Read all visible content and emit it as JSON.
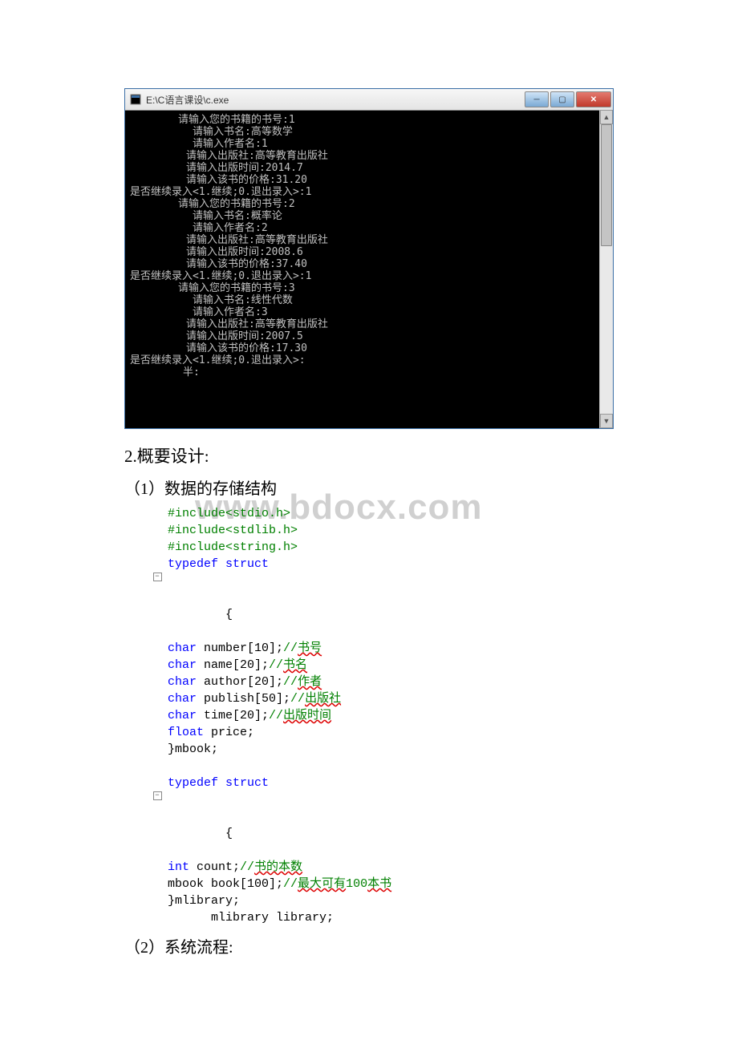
{
  "console": {
    "titlebar": {
      "path": "E:\\C语言课设\\c.exe"
    },
    "lines": [
      {
        "cls": "indent1",
        "t": "请输入您的书籍的书号:1"
      },
      {
        "cls": "indent2",
        "t": "请输入书名:高等数学"
      },
      {
        "cls": "indent2",
        "t": "请输入作者名:1"
      },
      {
        "cls": "indent3",
        "t": "请输入出版社:高等教育出版社"
      },
      {
        "cls": "indent3",
        "t": "请输入出版时间:2014.7"
      },
      {
        "cls": "indent3",
        "t": "请输入该书的价格:31.20"
      },
      {
        "cls": "",
        "t": ""
      },
      {
        "cls": "",
        "t": "是否继续录入<1.继续;0.退出录入>:1"
      },
      {
        "cls": "indent1",
        "t": "请输入您的书籍的书号:2"
      },
      {
        "cls": "indent2",
        "t": "请输入书名:概率论"
      },
      {
        "cls": "indent2",
        "t": "请输入作者名:2"
      },
      {
        "cls": "indent3",
        "t": "请输入出版社:高等教育出版社"
      },
      {
        "cls": "indent3",
        "t": "请输入出版时间:2008.6"
      },
      {
        "cls": "indent3",
        "t": "请输入该书的价格:37.40"
      },
      {
        "cls": "",
        "t": ""
      },
      {
        "cls": "",
        "t": "是否继续录入<1.继续;0.退出录入>:1"
      },
      {
        "cls": "indent1",
        "t": "请输入您的书籍的书号:3"
      },
      {
        "cls": "indent2",
        "t": "请输入书名:线性代数"
      },
      {
        "cls": "indent2",
        "t": "请输入作者名:3"
      },
      {
        "cls": "indent3",
        "t": "请输入出版社:高等教育出版社"
      },
      {
        "cls": "indent3",
        "t": "请输入出版时间:2007.5"
      },
      {
        "cls": "indent3",
        "t": "请输入该书的价格:17.30"
      },
      {
        "cls": "",
        "t": ""
      },
      {
        "cls": "",
        "t": "是否继续录入<1.继续;0.退出录入>:"
      },
      {
        "cls": "indent4",
        "t": "半:"
      }
    ]
  },
  "headings": {
    "section2": "2.概要设计:",
    "sub1": "（1）数据的存储结构",
    "sub2": "（2）系统流程:"
  },
  "watermark": "www.bdocx.com",
  "code": {
    "l1a": "#include",
    "l1b": "<stdio.h>",
    "l2a": "#include",
    "l2b": "<stdlib.h>",
    "l3a": "#include",
    "l3b": "<string.h>",
    "l4a": "typedef",
    "l4b": " struct",
    "l5": "{",
    "l6a": "char",
    "l6b": " number[10];",
    "l6c": "//",
    "l6d": "书号",
    "l7a": "char",
    "l7b": " name[20];",
    "l7c": "//",
    "l7d": "书名",
    "l8a": "char",
    "l8b": " author[20];",
    "l8c": "//",
    "l8d": "作者",
    "l9a": "char",
    "l9b": " publish[50];",
    "l9c": "//",
    "l9d": "出版社",
    "l10a": "char",
    "l10b": " time[20];",
    "l10c": "//",
    "l10d": "出版时间",
    "l11a": "float",
    "l11b": " price;",
    "l12": "}mbook;",
    "l13": "",
    "l14a": "typedef",
    "l14b": " struct",
    "l15": "{",
    "l16a": "int",
    "l16b": " count;",
    "l16c": "//",
    "l16d": "书的本数",
    "l17a": "mbook book[100];",
    "l17b": "//",
    "l17c": "最大可有",
    "l17d": "100",
    "l17e": "本书",
    "l18": "}mlibrary;",
    "l19": "      mlibrary library;"
  }
}
